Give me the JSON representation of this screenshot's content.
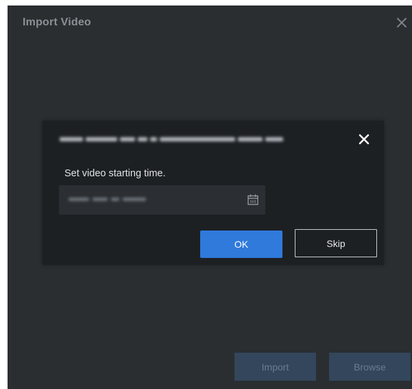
{
  "window": {
    "title": "Import Video",
    "close_icon": "close-icon",
    "buttons": {
      "import_label": "Import",
      "browse_label": "Browse"
    }
  },
  "dialog": {
    "file_name": "",
    "prompt": "Set video starting time.",
    "time_value": "",
    "calendar_icon": "calendar-icon",
    "close_icon": "close-icon",
    "ok_label": "OK",
    "skip_label": "Skip"
  },
  "colors": {
    "window_bg": "#2a2e31",
    "dialog_bg": "#1d2023",
    "primary": "#2f7adb",
    "disabled_button": "#33465b"
  }
}
